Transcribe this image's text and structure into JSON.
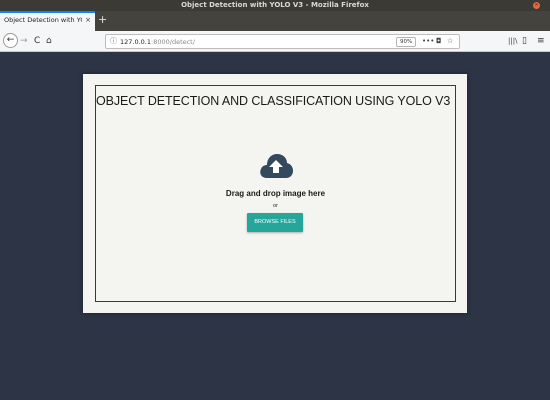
{
  "window": {
    "title": "Object Detection with YOLO V3 - Mozilla Firefox",
    "close_glyph": "×"
  },
  "tabs": [
    {
      "label": "Object Detection with YOLO",
      "close_glyph": "×"
    }
  ],
  "new_tab_glyph": "+",
  "nav": {
    "back_glyph": "←",
    "forward_glyph": "→",
    "reload_glyph": "C",
    "home_glyph": "⌂",
    "url_host": "127.0.0.1",
    "url_rest": ":8000/detect/",
    "zoom": "90%",
    "page_actions_glyph": "•••",
    "pocket_glyph": "◘",
    "bookmark_glyph": "☆",
    "library_glyph": "|||\\",
    "sidebar_glyph": "▯",
    "menu_glyph": "≡"
  },
  "page": {
    "heading": "OBJECT DETECTION AND CLASSIFICATION USING YOLO V3",
    "drag_text": "Drag and drop image here",
    "or_text": "or",
    "browse_label": "BROWSE FILES"
  },
  "colors": {
    "accent": "#26a69a",
    "page_bg": "#2c3446",
    "card_bg": "#f4f4f0",
    "cloud": "#34495e"
  }
}
